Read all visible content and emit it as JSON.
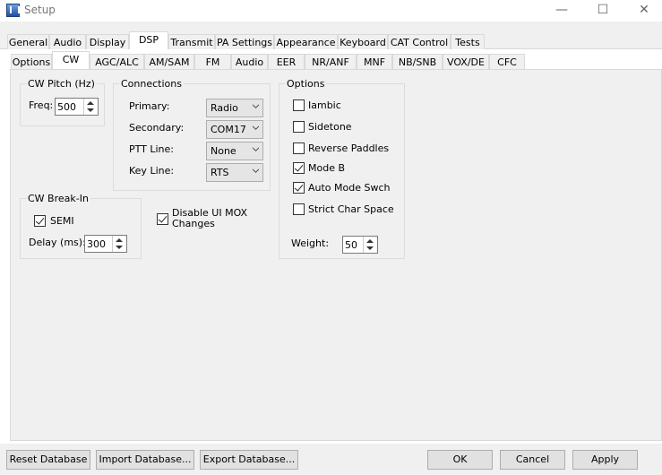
{
  "window": {
    "title": "Setup",
    "minimize": "—",
    "maximize": "☐",
    "close": "✕"
  },
  "main_tabs": [
    "General",
    "Audio",
    "Display",
    "DSP",
    "Transmit",
    "PA Settings",
    "Appearance",
    "Keyboard",
    "CAT Control",
    "Tests"
  ],
  "sub_tabs": [
    "Options",
    "CW",
    "AGC/ALC",
    "AM/SAM",
    "FM",
    "Audio",
    "EER",
    "NR/ANF",
    "MNF",
    "NB/SNB",
    "VOX/DE",
    "CFC"
  ],
  "cw_pitch": {
    "title": "CW Pitch (Hz)",
    "freq_label": "Freq:",
    "freq_value": "500"
  },
  "connections": {
    "title": "Connections",
    "primary_label": "Primary:",
    "primary_value": "Radio",
    "secondary_label": "Secondary:",
    "secondary_value": "COM17",
    "ptt_label": "PTT Line:",
    "ptt_value": "None",
    "key_label": "Key Line:",
    "key_value": "RTS"
  },
  "break_in": {
    "title": "CW Break-In",
    "semi_label": "SEMI",
    "semi_checked": true,
    "delay_label": "Delay (ms):",
    "delay_value": "300"
  },
  "disable_mox": {
    "label_line1": "Disable UI MOX",
    "label_line2": "Changes",
    "checked": true
  },
  "options": {
    "title": "Options",
    "iambic": "Iambic",
    "sidetone": "Sidetone",
    "reverse": "Reverse Paddles",
    "modeb": "Mode B",
    "auto": "Auto Mode Swch",
    "strict": "Strict Char Space",
    "weight_label": "Weight:",
    "weight_value": "50"
  },
  "bottom": {
    "reset": "Reset Database",
    "import": "Import Database...",
    "export": "Export Database...",
    "ok": "OK",
    "cancel": "Cancel",
    "apply": "Apply"
  }
}
